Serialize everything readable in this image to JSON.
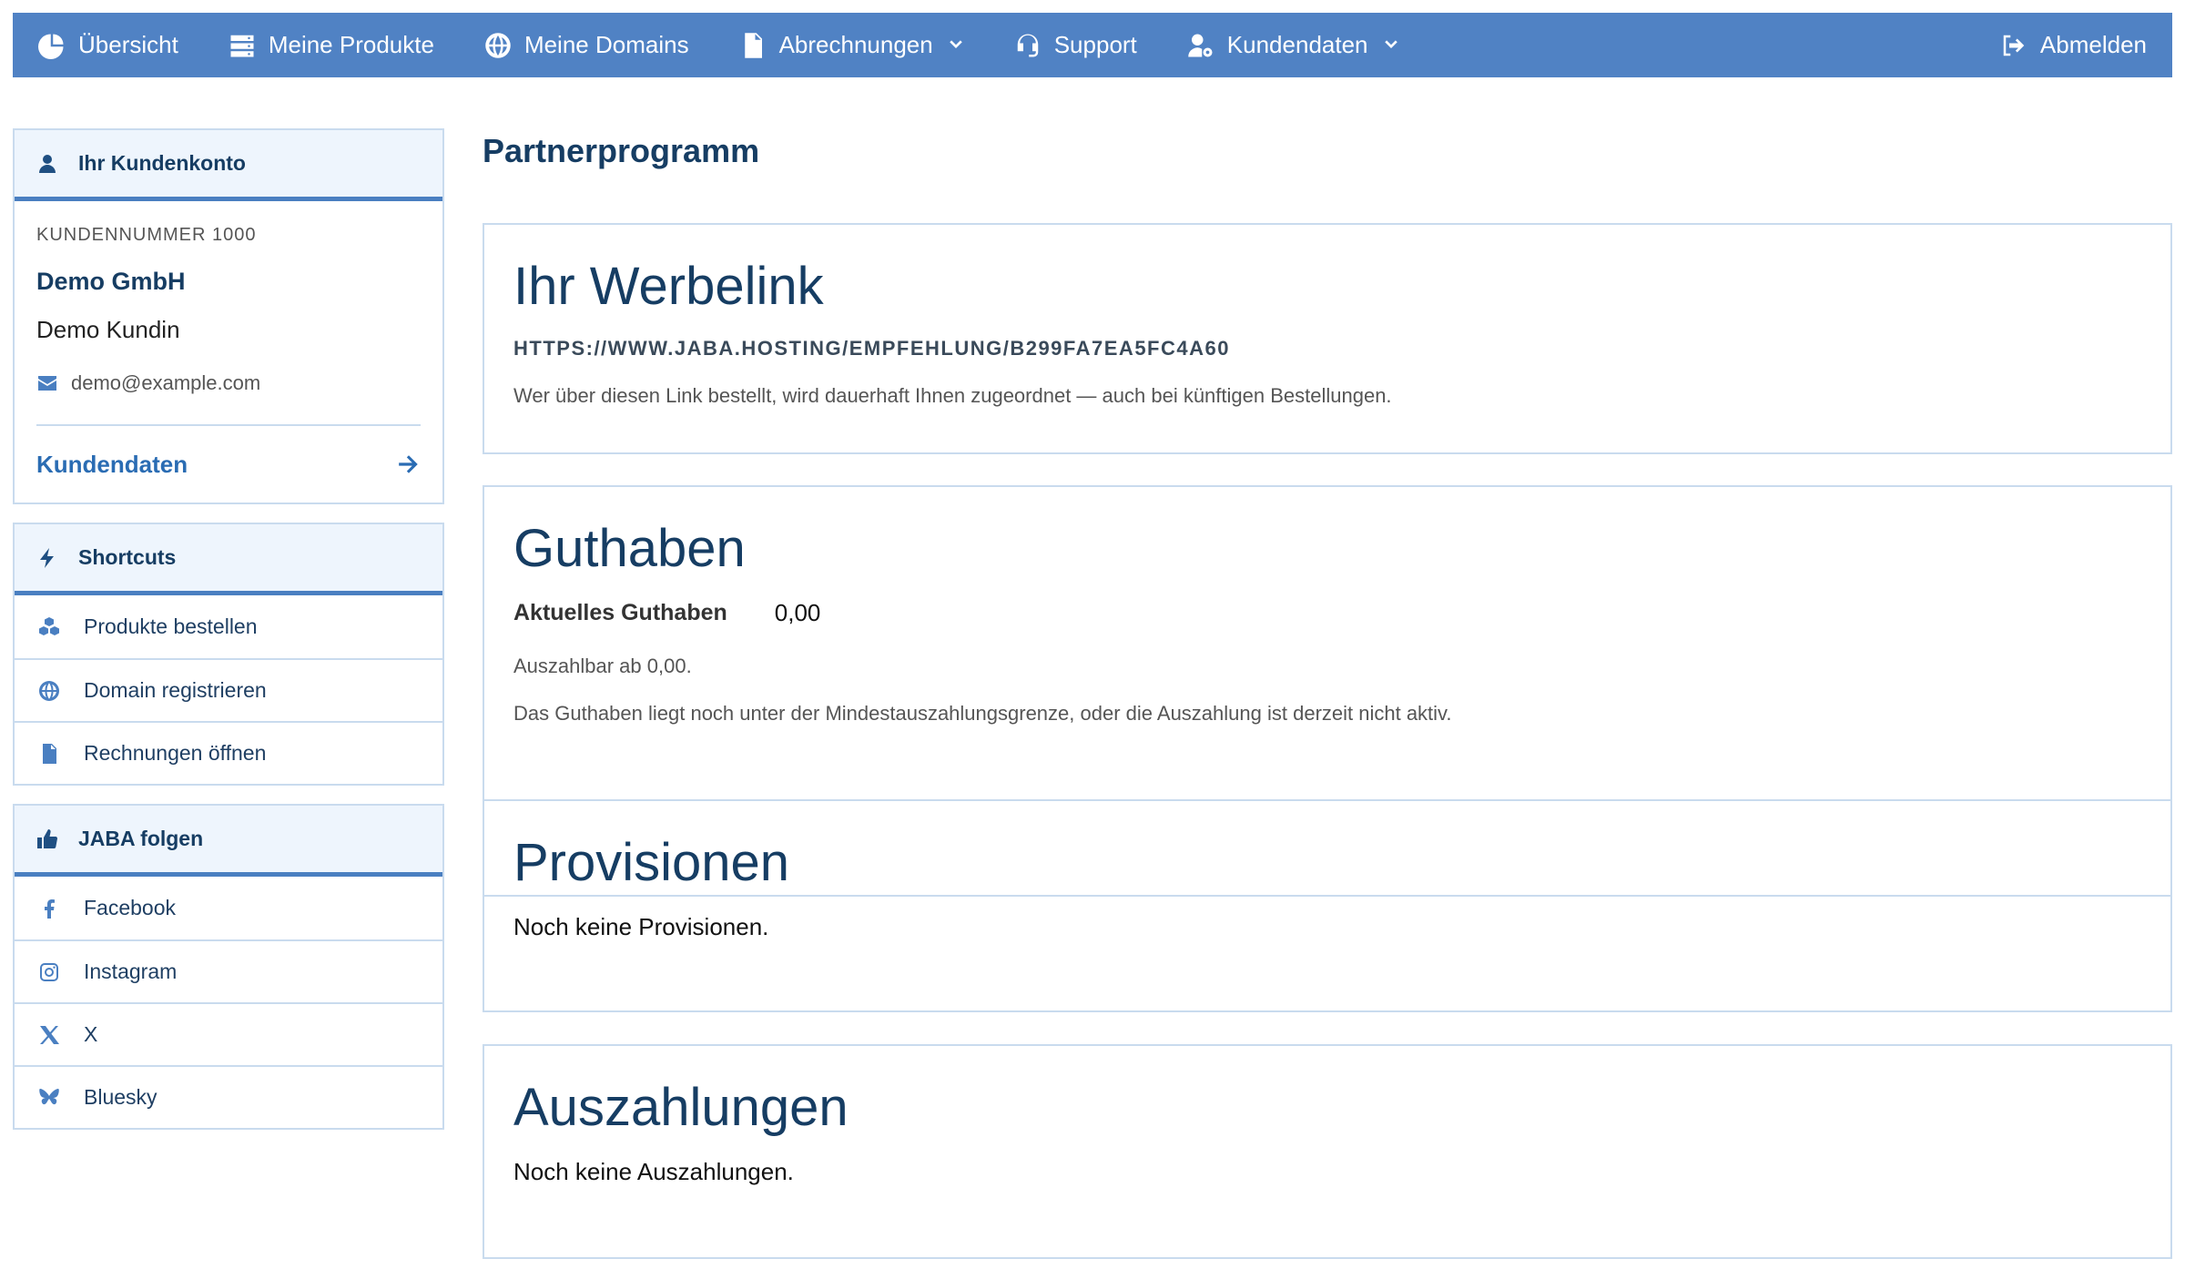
{
  "nav": {
    "items": [
      {
        "label": "Übersicht",
        "icon": "chart-pie-icon"
      },
      {
        "label": "Meine Produkte",
        "icon": "server-icon"
      },
      {
        "label": "Meine Domains",
        "icon": "globe-icon"
      },
      {
        "label": "Abrechnungen",
        "icon": "document-icon",
        "dropdown": true
      },
      {
        "label": "Support",
        "icon": "headset-icon"
      },
      {
        "label": "Kundendaten",
        "icon": "user-gear-icon",
        "dropdown": true
      }
    ],
    "logout_label": "Abmelden"
  },
  "sidebar": {
    "account": {
      "header": "Ihr Kundenkonto",
      "customer_number": "KUNDENNUMMER 1000",
      "company": "Demo GmbH",
      "person": "Demo Kundin",
      "email": "demo@example.com",
      "link_label": "Kundendaten"
    },
    "shortcuts": {
      "header": "Shortcuts",
      "items": [
        "Produkte bestellen",
        "Domain registrieren",
        "Rechnungen öffnen"
      ]
    },
    "follow": {
      "header": "JABA folgen",
      "items": [
        "Facebook",
        "Instagram",
        "X",
        "Bluesky"
      ]
    }
  },
  "main": {
    "title": "Partnerprogramm",
    "werbelink": {
      "heading": "Ihr Werbelink",
      "url": "HTTPS://WWW.JABA.HOSTING/EMPFEHLUNG/B299FA7EA5FC4A60",
      "note": "Wer über diesen Link bestellt, wird dauerhaft Ihnen zugeordnet — auch bei künftigen Bestellungen."
    },
    "guthaben": {
      "heading": "Guthaben",
      "label": "Aktuelles Guthaben",
      "value": "0,00",
      "payout_note": "Auszahlbar ab 0,00.",
      "status_note": "Das Guthaben liegt noch unter der Mindestauszahlungsgrenze, oder die Auszahlung ist derzeit nicht aktiv."
    },
    "provisionen": {
      "heading": "Provisionen",
      "empty": "Noch keine Provisionen."
    },
    "auszahlungen": {
      "heading": "Auszahlungen",
      "empty": "Noch keine Auszahlungen."
    }
  },
  "colors": {
    "nav_bg": "#5082c4",
    "accent": "#4a7fc1",
    "heading": "#163d63",
    "border": "#c9dbee",
    "panel_header_bg": "#eef5fd"
  }
}
